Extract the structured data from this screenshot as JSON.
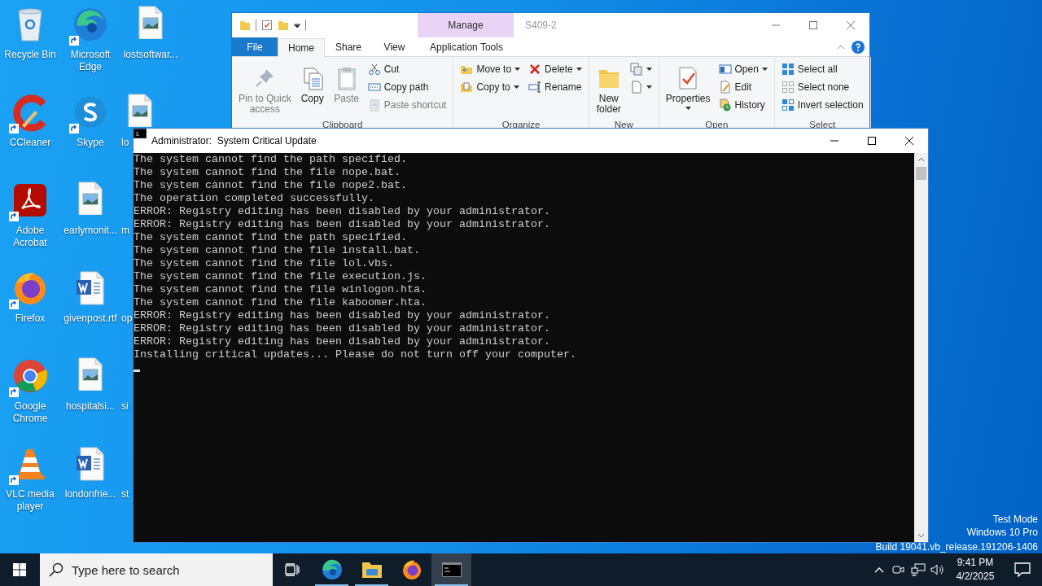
{
  "desktop": {
    "icons": [
      {
        "label": "Recycle Bin",
        "kind": "icon",
        "shortcut": false,
        "cut": false
      },
      {
        "label": "Microsoft Edge",
        "kind": "icon",
        "shortcut": true,
        "cut": false
      },
      {
        "label": "lostsoftwar...",
        "kind": "icon",
        "shortcut": false,
        "cut": false
      },
      {
        "label": "CCleaner",
        "kind": "icon",
        "shortcut": true,
        "cut": false
      },
      {
        "label": "Skype",
        "kind": "icon",
        "shortcut": true,
        "cut": false
      },
      {
        "label": "lo",
        "kind": "icon",
        "shortcut": false,
        "cut": true
      },
      {
        "label": "Adobe Acrobat",
        "kind": "icon",
        "shortcut": true,
        "cut": false
      },
      {
        "label": "earlymonit...",
        "kind": "icon",
        "shortcut": false,
        "cut": false
      },
      {
        "label": "m",
        "kind": "label",
        "cut": true
      },
      {
        "label": "Firefox",
        "kind": "icon",
        "shortcut": true,
        "cut": false
      },
      {
        "label": "givenpost.rtf",
        "kind": "icon",
        "shortcut": false,
        "cut": false
      },
      {
        "label": "op",
        "kind": "label",
        "cut": true
      },
      {
        "label": "Google Chrome",
        "kind": "icon",
        "shortcut": true,
        "cut": false
      },
      {
        "label": "hospitalsi...",
        "kind": "icon",
        "shortcut": false,
        "cut": false
      },
      {
        "label": "si",
        "kind": "label",
        "cut": true
      },
      {
        "label": "VLC media player",
        "kind": "icon",
        "shortcut": true,
        "cut": false
      },
      {
        "label": "londonfrie...",
        "kind": "icon",
        "shortcut": false,
        "cut": false
      },
      {
        "label": "st",
        "kind": "label",
        "cut": true
      }
    ],
    "system_notice": [
      "Test Mode",
      "Windows 10 Pro",
      "Build 19041.vb_release.191206-1406"
    ]
  },
  "explorer": {
    "context_tab": "Manage",
    "title": "S409-2",
    "tabs": [
      {
        "label": "File",
        "kind": "file",
        "selected": false
      },
      {
        "label": "Home",
        "kind": "tab",
        "selected": true
      },
      {
        "label": "Share",
        "kind": "tab",
        "selected": false
      },
      {
        "label": "View",
        "kind": "tab",
        "selected": false
      },
      {
        "label": "Application Tools",
        "kind": "context",
        "selected": false
      }
    ],
    "groups": [
      {
        "label": "Clipboard",
        "columns": [
          [
            {
              "label": "Pin to Quick\naccess",
              "kind": "large",
              "disabled": true,
              "dropdown": false
            }
          ],
          [
            {
              "label": "Copy",
              "kind": "large",
              "disabled": false,
              "dropdown": false
            }
          ],
          [
            {
              "label": "Paste",
              "kind": "large",
              "disabled": true,
              "dropdown": false
            }
          ],
          [
            {
              "label": "Cut",
              "kind": "small",
              "disabled": false,
              "dropdown": false
            },
            {
              "label": "Copy path",
              "kind": "small",
              "disabled": false,
              "dropdown": false
            },
            {
              "label": "Paste shortcut",
              "kind": "small",
              "disabled": true,
              "dropdown": false
            }
          ]
        ]
      },
      {
        "label": "Organize",
        "columns": [
          [
            {
              "label": "Move to",
              "kind": "small",
              "disabled": false,
              "dropdown": true
            },
            {
              "label": "Copy to",
              "kind": "small",
              "disabled": false,
              "dropdown": true
            }
          ],
          [
            {
              "label": "Delete",
              "kind": "small",
              "disabled": false,
              "dropdown": true
            },
            {
              "label": "Rename",
              "kind": "small",
              "disabled": false,
              "dropdown": false
            }
          ]
        ]
      },
      {
        "label": "New",
        "columns": [
          [
            {
              "label": "New\nfolder",
              "kind": "large",
              "disabled": false,
              "dropdown": false
            }
          ],
          [
            {
              "kind": "small",
              "disabled": false,
              "dropdown": true
            },
            {
              "kind": "small",
              "disabled": false,
              "dropdown": true
            }
          ]
        ]
      },
      {
        "label": "Open",
        "columns": [
          [
            {
              "label": "Properties",
              "kind": "large",
              "disabled": false,
              "dropdown": true
            }
          ],
          [
            {
              "label": "Open",
              "kind": "small",
              "disabled": false,
              "dropdown": true
            },
            {
              "label": "Edit",
              "kind": "small",
              "disabled": false,
              "dropdown": false
            },
            {
              "label": "History",
              "kind": "small",
              "disabled": false,
              "dropdown": false
            }
          ]
        ]
      },
      {
        "label": "Select",
        "columns": [
          [
            {
              "label": "Select all",
              "kind": "small",
              "disabled": false,
              "dropdown": false
            },
            {
              "label": "Select none",
              "kind": "small",
              "disabled": false,
              "dropdown": false
            },
            {
              "label": "Invert selection",
              "kind": "small",
              "disabled": false,
              "dropdown": false
            }
          ]
        ]
      }
    ]
  },
  "console": {
    "title": "Administrator:  System Critical Update",
    "cursor": true,
    "lines": [
      "The system cannot find the path specified.",
      "The system cannot find the file nope.bat.",
      "The system cannot find the file nope2.bat.",
      "The operation completed successfully.",
      "ERROR: Registry editing has been disabled by your administrator.",
      "ERROR: Registry editing has been disabled by your administrator.",
      "The system cannot find the path specified.",
      "The system cannot find the file install.bat.",
      "The system cannot find the file lol.vbs.",
      "The system cannot find the file execution.js.",
      "The system cannot find the file winlogon.hta.",
      "The system cannot find the file kaboomer.hta.",
      "ERROR: Registry editing has been disabled by your administrator.",
      "ERROR: Registry editing has been disabled by your administrator.",
      "ERROR: Registry editing has been disabled by your administrator.",
      "Installing critical updates... Please do not turn off your computer."
    ]
  },
  "taskbar": {
    "search": {
      "placeholder": "Type here to search"
    },
    "apps": [
      {
        "running": true,
        "selected": false
      },
      {
        "running": true,
        "selected": false
      },
      {
        "running": false,
        "selected": false
      },
      {
        "running": true,
        "selected": true
      }
    ],
    "time": "9:41 PM",
    "date": "4/2/2025"
  }
}
